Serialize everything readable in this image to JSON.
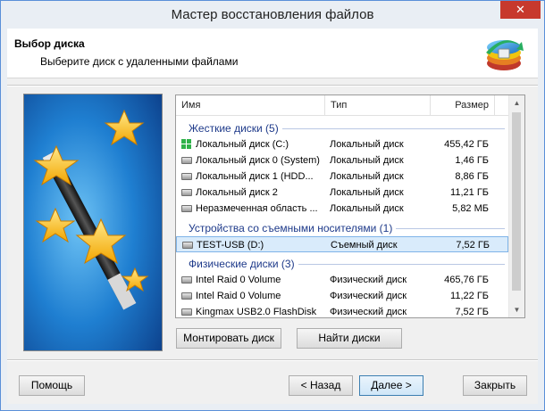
{
  "window": {
    "title": "Мастер восстановления файлов",
    "close_glyph": "✕"
  },
  "header": {
    "title": "Выбор диска",
    "subtitle": "Выберите диск с удаленными файлами"
  },
  "list": {
    "columns": {
      "name": "Имя",
      "type": "Тип",
      "size": "Размер"
    },
    "groups": [
      {
        "label": "Жесткие диски (5)",
        "items": [
          {
            "icon": "windows-drive-icon",
            "name": "Локальный диск (C:)",
            "type": "Локальный диск",
            "size": "455,42 ГБ"
          },
          {
            "icon": "hard-drive-icon",
            "name": "Локальный диск 0 (System)",
            "type": "Локальный диск",
            "size": "1,46 ГБ"
          },
          {
            "icon": "hard-drive-icon",
            "name": "Локальный диск 1 (HDD...",
            "type": "Локальный диск",
            "size": "8,86 ГБ"
          },
          {
            "icon": "hard-drive-icon",
            "name": "Локальный диск 2",
            "type": "Локальный диск",
            "size": "11,21 ГБ"
          },
          {
            "icon": "hard-drive-icon",
            "name": "Неразмеченная область ...",
            "type": "Локальный диск",
            "size": "5,82 МБ"
          }
        ]
      },
      {
        "label": "Устройства со съемными носителями (1)",
        "items": [
          {
            "icon": "usb-drive-icon",
            "name": "TEST-USB (D:)",
            "type": "Съемный диск",
            "size": "7,52 ГБ",
            "selected": true
          }
        ]
      },
      {
        "label": "Физические диски (3)",
        "items": [
          {
            "icon": "hard-drive-icon",
            "name": "Intel Raid 0 Volume",
            "type": "Физический диск",
            "size": "465,76 ГБ"
          },
          {
            "icon": "hard-drive-icon",
            "name": "Intel Raid 0 Volume",
            "type": "Физический диск",
            "size": "11,22 ГБ"
          },
          {
            "icon": "hard-drive-icon",
            "name": "Kingmax USB2.0 FlashDisk",
            "type": "Физический диск",
            "size": "7,52 ГБ"
          }
        ]
      }
    ]
  },
  "buttons": {
    "mount": "Монтировать диск",
    "find": "Найти диски",
    "help": "Помощь",
    "back": "< Назад",
    "next": "Далее >",
    "close": "Закрыть"
  },
  "colors": {
    "accent": "#3c7fb1",
    "group_text": "#1e3a8a",
    "selection": "#d9ebfb",
    "close_red": "#c7392d"
  }
}
